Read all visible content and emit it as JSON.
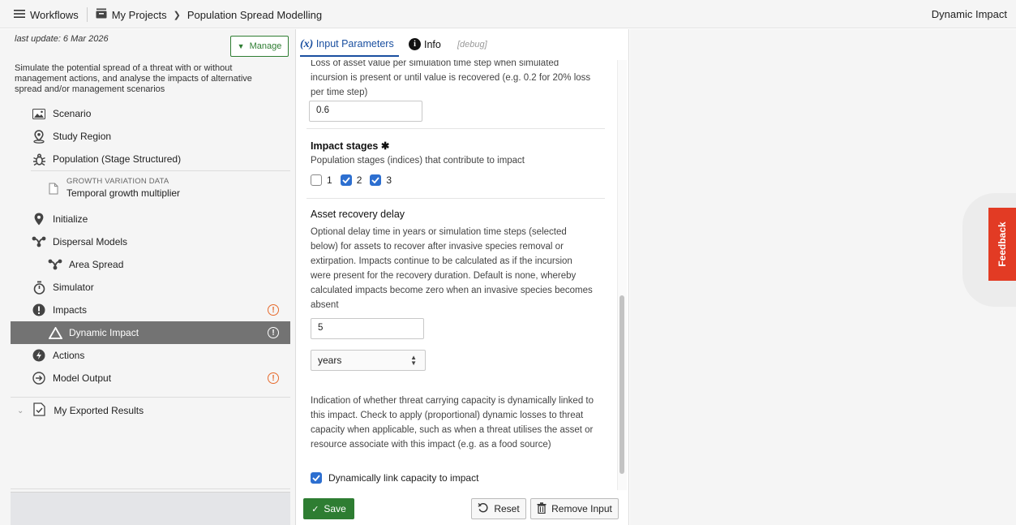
{
  "header": {
    "workflows": "Workflows",
    "projects": "My Projects",
    "crumb": "Population Spread Modelling",
    "right_title": "Dynamic Impact"
  },
  "sidebar": {
    "last_update": "last update: 6 Mar 2026",
    "manage": "Manage",
    "description": "Simulate the potential spread of a threat with or without management actions, and analyse the impacts of alternative spread and/or management scenarios",
    "items": [
      {
        "label": "Scenario"
      },
      {
        "label": "Study Region"
      },
      {
        "label": "Population (Stage Structured)"
      },
      {
        "label": "Initialize"
      },
      {
        "label": "Dispersal Models"
      },
      {
        "label": "Area Spread"
      },
      {
        "label": "Simulator"
      },
      {
        "label": "Impacts"
      },
      {
        "label": "Dynamic Impact"
      },
      {
        "label": "Actions"
      },
      {
        "label": "Model Output"
      }
    ],
    "growth_small": "GROWTH VARIATION DATA",
    "growth_label": "Temporal growth multiplier",
    "exported": "My Exported Results"
  },
  "tabs": {
    "input_x": "(x)",
    "input": "Input Parameters",
    "info": "Info",
    "debug": "[debug]"
  },
  "form": {
    "loss_desc": "Loss of asset value per simulation time step when simulated incursion is present or until value is recovered (e.g. 0.2 for 20% loss per time step)",
    "loss_value": "0.6",
    "impact_stages_title": "Impact stages ✱",
    "impact_stages_desc": "Population stages (indices) that contribute to impact",
    "stages": [
      {
        "label": "1",
        "checked": false
      },
      {
        "label": "2",
        "checked": true
      },
      {
        "label": "3",
        "checked": true
      }
    ],
    "recovery_title": "Asset recovery delay",
    "recovery_desc": "Optional delay time in years or simulation time steps (selected below) for assets to recover after invasive species removal or extirpation. Impacts continue to be calculated as if the incursion were present for the recovery duration. Default is none, whereby calculated impacts become zero when an invasive species becomes absent",
    "recovery_value": "5",
    "recovery_unit": "years",
    "capacity_desc": "Indication of whether threat carrying capacity is dynamically linked to this impact. Check to apply (proportional) dynamic losses to threat capacity when applicable, such as when a threat utilises the asset or resource associate with this impact (e.g. as a food source)",
    "capacity_label": "Dynamically link capacity to impact"
  },
  "footer": {
    "save": "Save",
    "reset": "Reset",
    "remove": "Remove Input"
  },
  "feedback": "Feedback",
  "colors": {
    "accent_green": "#2e7d32",
    "tab_blue": "#1a4fa0",
    "checkbox_blue": "#2d6fd0",
    "warning_orange": "#e66a2c",
    "feedback_red": "#e23b24",
    "active_row": "#737373"
  }
}
